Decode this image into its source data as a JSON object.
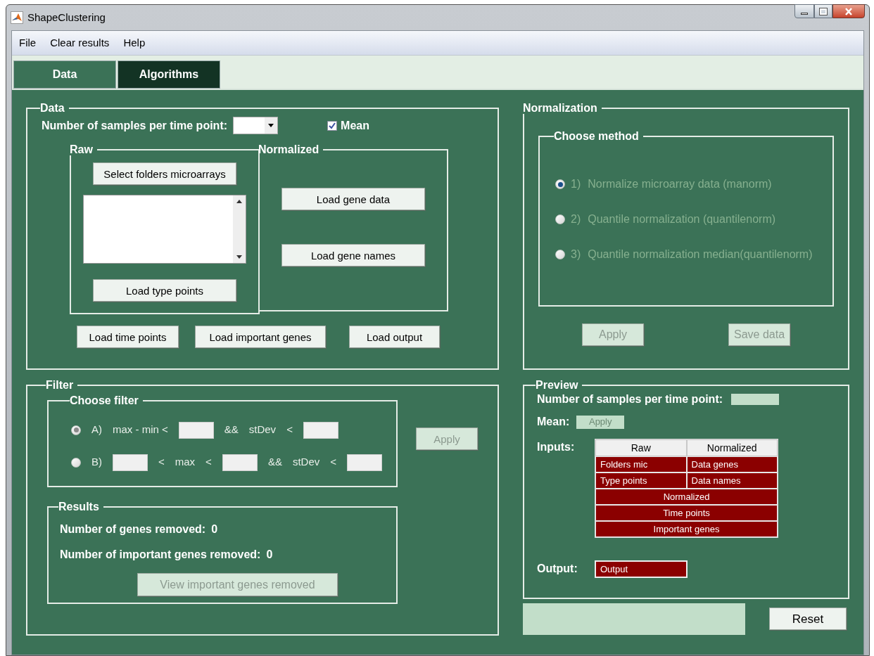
{
  "window": {
    "title": "ShapeClustering"
  },
  "menu": [
    "File",
    "Clear results",
    "Help"
  ],
  "tabs": [
    {
      "label": "Data",
      "selected": false
    },
    {
      "label": "Algorithms",
      "selected": true
    }
  ],
  "data_panel": {
    "title": "Data",
    "samples_label": "Number of samples per time point:",
    "mean": {
      "label": "Mean",
      "checked": true
    },
    "raw": {
      "title": "Raw",
      "buttons": [
        "Select folders microarrays",
        "Load type points"
      ]
    },
    "normalized": {
      "title": "Normalized",
      "buttons": [
        "Load gene data",
        "Load gene names"
      ]
    },
    "buttons": [
      "Load time points",
      "Load important genes",
      "Load output"
    ]
  },
  "normalization": {
    "title": "Normalization",
    "method_title": "Choose method",
    "options": [
      {
        "number": "1)",
        "label": "Normalize microarray data (manorm)",
        "selected": true,
        "disabled": true
      },
      {
        "number": "2)",
        "label": "Quantile normalization (quantilenorm)",
        "selected": false,
        "disabled": true
      },
      {
        "number": "3)",
        "label": "Quantile normalization median(quantilenorm)",
        "selected": false,
        "disabled": true
      }
    ],
    "buttons": [
      {
        "label": "Apply",
        "disabled": true
      },
      {
        "label": "Save data",
        "disabled": true
      }
    ]
  },
  "filter": {
    "title": "Filter",
    "choose_title": "Choose filter",
    "options": [
      {
        "selected": true,
        "parts": [
          {
            "kind": "text",
            "text": "A)"
          },
          {
            "kind": "text",
            "text": "max - min <"
          },
          {
            "kind": "field"
          },
          {
            "kind": "text",
            "text": "&&"
          },
          {
            "kind": "text",
            "text": "stDev"
          },
          {
            "kind": "text",
            "text": "<"
          },
          {
            "kind": "field"
          }
        ]
      },
      {
        "selected": false,
        "parts": [
          {
            "kind": "text",
            "text": "B)"
          },
          {
            "kind": "field"
          },
          {
            "kind": "text",
            "text": "<"
          },
          {
            "kind": "text",
            "text": "max"
          },
          {
            "kind": "text",
            "text": "<"
          },
          {
            "kind": "field"
          },
          {
            "kind": "text",
            "text": "&&"
          },
          {
            "kind": "text",
            "text": "stDev"
          },
          {
            "kind": "text",
            "text": "<"
          },
          {
            "kind": "field"
          }
        ]
      }
    ],
    "apply": {
      "label": "Apply",
      "disabled": true
    },
    "results": {
      "title": "Results",
      "rows": [
        {
          "label": "Number of genes removed:",
          "value": "0"
        },
        {
          "label": "Number of important genes removed:",
          "value": "0"
        }
      ],
      "button": {
        "label": "View important genes removed",
        "disabled": true
      }
    }
  },
  "preview": {
    "title": "Preview",
    "samples_label": "Number of samples per time point:",
    "mean_label": "Mean:",
    "mean_value": "Apply",
    "inputs_label": "Inputs:",
    "table": {
      "columns": [
        "Raw",
        "Normalized"
      ],
      "rows": [
        [
          "Folders mic",
          "Data genes"
        ],
        [
          "Type points",
          "Data names"
        ]
      ],
      "wide_rows": [
        "Normalized",
        "Time points",
        "Important genes"
      ]
    },
    "output_label": "Output:",
    "output": "Output"
  },
  "reset": "Reset"
}
